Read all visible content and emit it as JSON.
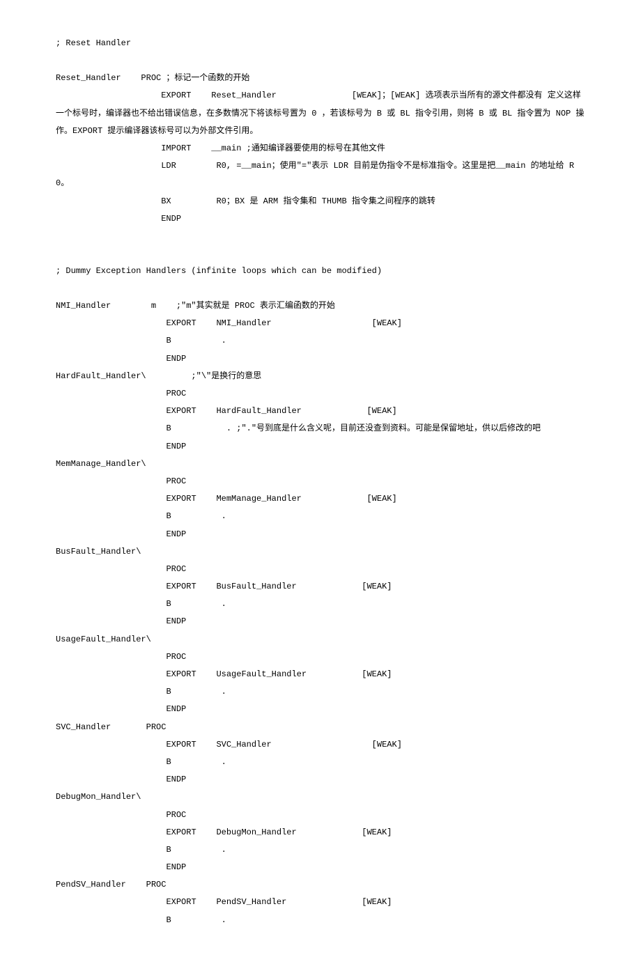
{
  "lines": [
    {
      "cls": "indent0",
      "text": "; Reset Handler"
    },
    {
      "cls": "blank",
      "text": ""
    },
    {
      "cls": "indent0",
      "text": "Reset_Handler    PROC ；标记一个函数的开始"
    },
    {
      "cls": "indent0",
      "text": "                     EXPORT    Reset_Handler               [WEAK]；[WEAK] 选项表示当所有的源文件都没有 定义这样一个标号时，编译器也不给出错误信息，在多数情况下将该标号置为 0 ，若该标号为 B 或 BL 指令引用，则将 B 或 BL 指令置为 NOP 操作。EXPORT 提示编译器该标号可以为外部文件引用。"
    },
    {
      "cls": "indent0",
      "text": "                     IMPORT    __main ;通知编译器要使用的标号在其他文件"
    },
    {
      "cls": "indent0",
      "text": "                     LDR        R0, =__main；使用\"=\"表示 LDR 目前是伪指令不是标准指令。这里是把__main 的地址给 R0。"
    },
    {
      "cls": "indent0",
      "text": "                     BX         R0；BX 是 ARM 指令集和 THUMB 指令集之间程序的跳转"
    },
    {
      "cls": "indent0",
      "text": "                     ENDP"
    },
    {
      "cls": "blank2",
      "text": ""
    },
    {
      "cls": "indent0",
      "text": "; Dummy Exception Handlers (infinite loops which can be modified)"
    },
    {
      "cls": "blank",
      "text": ""
    },
    {
      "cls": "indent0",
      "text": "NMI_Handler        m    ;\"m\"其实就是 PROC 表示汇编函数的开始"
    },
    {
      "cls": "indent0",
      "text": "                      EXPORT    NMI_Handler                    [WEAK]"
    },
    {
      "cls": "indent0",
      "text": "                      B          ."
    },
    {
      "cls": "indent0",
      "text": "                      ENDP"
    },
    {
      "cls": "indent0",
      "text": "HardFault_Handler\\         ;\"\\\"是换行的意思"
    },
    {
      "cls": "indent0",
      "text": "                      PROC"
    },
    {
      "cls": "indent0",
      "text": "                      EXPORT    HardFault_Handler             [WEAK]"
    },
    {
      "cls": "indent0",
      "text": "                      B           . ;\".\"号到底是什么含义呢，目前还没查到资料。可能是保留地址，供以后修改的吧"
    },
    {
      "cls": "indent0",
      "text": "                      ENDP"
    },
    {
      "cls": "indent0",
      "text": "MemManage_Handler\\"
    },
    {
      "cls": "indent0",
      "text": "                      PROC"
    },
    {
      "cls": "indent0",
      "text": "                      EXPORT    MemManage_Handler             [WEAK]"
    },
    {
      "cls": "indent0",
      "text": "                      B          ."
    },
    {
      "cls": "indent0",
      "text": "                      ENDP"
    },
    {
      "cls": "indent0",
      "text": "BusFault_Handler\\"
    },
    {
      "cls": "indent0",
      "text": "                      PROC"
    },
    {
      "cls": "indent0",
      "text": "                      EXPORT    BusFault_Handler             [WEAK]"
    },
    {
      "cls": "indent0",
      "text": "                      B          ."
    },
    {
      "cls": "indent0",
      "text": "                      ENDP"
    },
    {
      "cls": "indent0",
      "text": "UsageFault_Handler\\"
    },
    {
      "cls": "indent0",
      "text": "                      PROC"
    },
    {
      "cls": "indent0",
      "text": "                      EXPORT    UsageFault_Handler           [WEAK]"
    },
    {
      "cls": "indent0",
      "text": "                      B          ."
    },
    {
      "cls": "indent0",
      "text": "                      ENDP"
    },
    {
      "cls": "indent0",
      "text": "SVC_Handler       PROC"
    },
    {
      "cls": "indent0",
      "text": "                      EXPORT    SVC_Handler                    [WEAK]"
    },
    {
      "cls": "indent0",
      "text": "                      B          ."
    },
    {
      "cls": "indent0",
      "text": "                      ENDP"
    },
    {
      "cls": "indent0",
      "text": "DebugMon_Handler\\"
    },
    {
      "cls": "indent0",
      "text": "                      PROC"
    },
    {
      "cls": "indent0",
      "text": "                      EXPORT    DebugMon_Handler             [WEAK]"
    },
    {
      "cls": "indent0",
      "text": "                      B          ."
    },
    {
      "cls": "indent0",
      "text": "                      ENDP"
    },
    {
      "cls": "indent0",
      "text": "PendSV_Handler    PROC"
    },
    {
      "cls": "indent0",
      "text": "                      EXPORT    PendSV_Handler               [WEAK]"
    },
    {
      "cls": "indent0",
      "text": "                      B          ."
    }
  ]
}
